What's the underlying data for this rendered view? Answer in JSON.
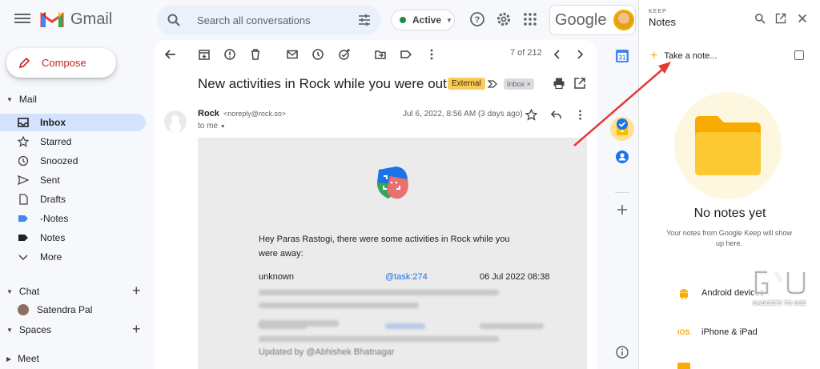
{
  "header": {
    "app_name": "Gmail",
    "search_placeholder": "Search all conversations",
    "status": "Active",
    "account_brand": "Google"
  },
  "sidebar": {
    "compose_label": "Compose",
    "mail_section": "Mail",
    "items": [
      {
        "label": "Inbox",
        "icon": "inbox-icon",
        "active": true
      },
      {
        "label": "Starred",
        "icon": "star-icon"
      },
      {
        "label": "Snoozed",
        "icon": "clock-icon"
      },
      {
        "label": "Sent",
        "icon": "send-icon"
      },
      {
        "label": "Drafts",
        "icon": "draft-icon"
      },
      {
        "label": "-Notes",
        "icon": "label-icon",
        "color": "#4285f4"
      },
      {
        "label": "Notes",
        "icon": "label-icon",
        "color": "#202124"
      },
      {
        "label": "More",
        "icon": "chevron-down-icon"
      }
    ],
    "chat_section": "Chat",
    "chat_user": "Satendra Pal",
    "spaces_section": "Spaces",
    "meet_section": "Meet"
  },
  "email": {
    "pager": "7 of 212",
    "subject": "New activities in Rock while you were out",
    "label_external": "External",
    "label_inbox": "Inbox ×",
    "sender_name": "Rock",
    "sender_email": "<noreply@rock.so>",
    "to": "to me",
    "date": "Jul 6, 2022, 8:56 AM (3 days ago)",
    "greeting": "Hey Paras Rastogi, there were some activities in Rock while you were away:",
    "row1_user": "unknown",
    "row1_task": "@task:274",
    "row1_date": "06 Jul 2022 08:38",
    "updated_by": "Updated by @Abhishek Bhatnagar"
  },
  "keep": {
    "brand": "KEEP",
    "title": "Notes",
    "take_note": "Take a note...",
    "empty_title": "No notes yet",
    "empty_desc": "Your notes from Google Keep will show up here.",
    "devices": [
      {
        "label": "Android devices",
        "icon": "android-icon"
      },
      {
        "label": "iPhone & iPad",
        "icon": "ios-icon"
      }
    ]
  },
  "watermark": {
    "text": "GADGETS TO USE"
  },
  "colors": {
    "accent_red": "#ea4335",
    "keep_yellow": "#f9ab00",
    "active_nav": "#d3e3fd"
  }
}
